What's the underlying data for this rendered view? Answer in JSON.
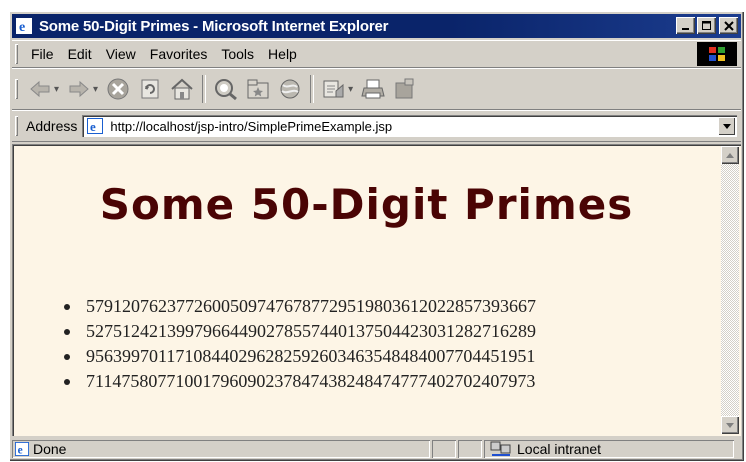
{
  "window": {
    "title": "Some 50-Digit Primes - Microsoft Internet Explorer"
  },
  "menu": {
    "file": "File",
    "edit": "Edit",
    "view": "View",
    "favorites": "Favorites",
    "tools": "Tools",
    "help": "Help"
  },
  "toolbar": {
    "buttons": [
      "back-icon",
      "forward-icon",
      "stop-icon",
      "refresh-icon",
      "home-icon",
      "search-icon",
      "favorites-icon",
      "history-icon",
      "mail-icon",
      "print-icon",
      "edit-icon"
    ]
  },
  "address": {
    "label": "Address",
    "url": "http://localhost/jsp-intro/SimplePrimeExample.jsp"
  },
  "page": {
    "heading": "Some 50-Digit Primes",
    "primes": [
      "57912076237726005097476787729519803612022857393667",
      "52751242139979664490278557440137504423031282716289",
      "95639970117108440296282592603463548484007704451951",
      "71147580771001796090237847438248474777402702407973"
    ]
  },
  "status": {
    "text": "Done",
    "zone": "Local intranet"
  },
  "colors": {
    "titlebar": "#0a246a",
    "chrome": "#d4d0c8",
    "page_background": "#fdf5e6",
    "heading": "#4a0404"
  }
}
